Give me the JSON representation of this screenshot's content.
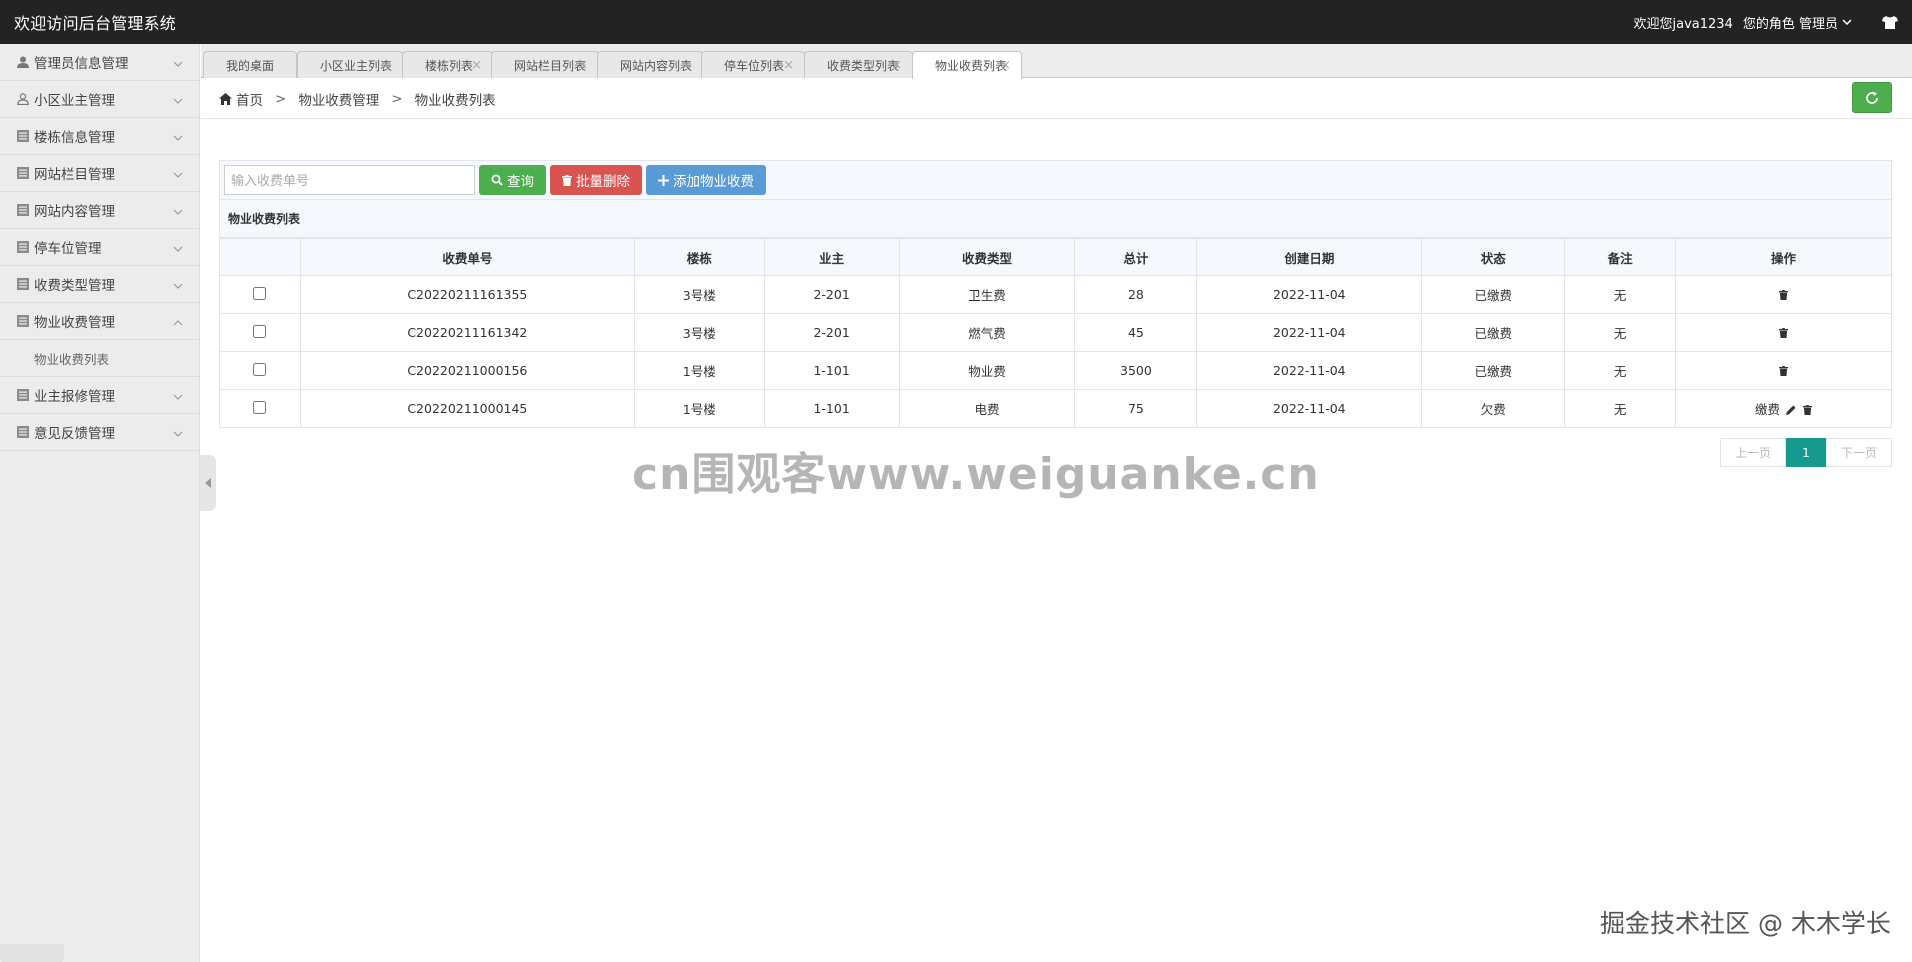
{
  "app": {
    "title": "欢迎访问后台管理系统",
    "welcome": "欢迎您java1234",
    "role_label": "您的角色 管理员"
  },
  "sidebar": {
    "items": [
      {
        "label": "管理员信息管理",
        "icon": "user-icon",
        "expanded": false
      },
      {
        "label": "小区业主管理",
        "icon": "user-outline-icon",
        "expanded": false
      },
      {
        "label": "楼栋信息管理",
        "icon": "list-icon",
        "expanded": false
      },
      {
        "label": "网站栏目管理",
        "icon": "list-icon",
        "expanded": false
      },
      {
        "label": "网站内容管理",
        "icon": "list-icon",
        "expanded": false
      },
      {
        "label": "停车位管理",
        "icon": "list-icon",
        "expanded": false
      },
      {
        "label": "收费类型管理",
        "icon": "list-icon",
        "expanded": false
      },
      {
        "label": "物业收费管理",
        "icon": "list-icon",
        "expanded": true
      },
      {
        "label": "业主报修管理",
        "icon": "list-icon",
        "expanded": false
      },
      {
        "label": "意见反馈管理",
        "icon": "list-icon",
        "expanded": false
      }
    ],
    "sub_item": "物业收费列表"
  },
  "tabs": [
    {
      "label": "我的桌面",
      "closable": false,
      "active": false
    },
    {
      "label": "小区业主列表",
      "closable": true,
      "active": false
    },
    {
      "label": "楼栋列表",
      "closable": true,
      "active": false
    },
    {
      "label": "网站栏目列表",
      "closable": true,
      "active": false
    },
    {
      "label": "网站内容列表",
      "closable": true,
      "active": false
    },
    {
      "label": "停车位列表",
      "closable": true,
      "active": false
    },
    {
      "label": "收费类型列表",
      "closable": true,
      "active": false
    },
    {
      "label": "物业收费列表",
      "closable": true,
      "active": true
    }
  ],
  "breadcrumb": {
    "home": "首页",
    "level1": "物业收费管理",
    "level2": "物业收费列表",
    "separator": ">"
  },
  "toolbar": {
    "search_placeholder": "输入收费单号",
    "search_value": "",
    "query_label": "查询",
    "batch_delete_label": "批量删除",
    "add_label": "添加物业收费"
  },
  "table": {
    "caption": "物业收费列表",
    "headers": [
      "收费单号",
      "楼栋",
      "业主",
      "收费类型",
      "总计",
      "创建日期",
      "状态",
      "备注",
      "操作"
    ],
    "rows": [
      {
        "no": "C20220211161355",
        "building": "3号楼",
        "owner": "2-201",
        "type": "卫生费",
        "total": "28",
        "date": "2022-11-04",
        "status": "已缴费",
        "note": "无",
        "pay": ""
      },
      {
        "no": "C20220211161342",
        "building": "3号楼",
        "owner": "2-201",
        "type": "燃气费",
        "total": "45",
        "date": "2022-11-04",
        "status": "已缴费",
        "note": "无",
        "pay": ""
      },
      {
        "no": "C20220211000156",
        "building": "1号楼",
        "owner": "1-101",
        "type": "物业费",
        "total": "3500",
        "date": "2022-11-04",
        "status": "已缴费",
        "note": "无",
        "pay": ""
      },
      {
        "no": "C20220211000145",
        "building": "1号楼",
        "owner": "1-101",
        "type": "电费",
        "total": "75",
        "date": "2022-11-04",
        "status": "欠费",
        "note": "无",
        "pay": "缴费"
      }
    ]
  },
  "pager": {
    "prev": "上一页",
    "current": "1",
    "next": "下一页"
  },
  "watermarks": {
    "center": "cn围观客www.weiguanke.cn",
    "corner": "掘金技术社区 @ 木木学长"
  },
  "colors": {
    "topbar": "#232323",
    "green": "#4cae4c",
    "red": "#d9534f",
    "blue": "#5b9bd5",
    "pager_active": "#169a8f"
  }
}
